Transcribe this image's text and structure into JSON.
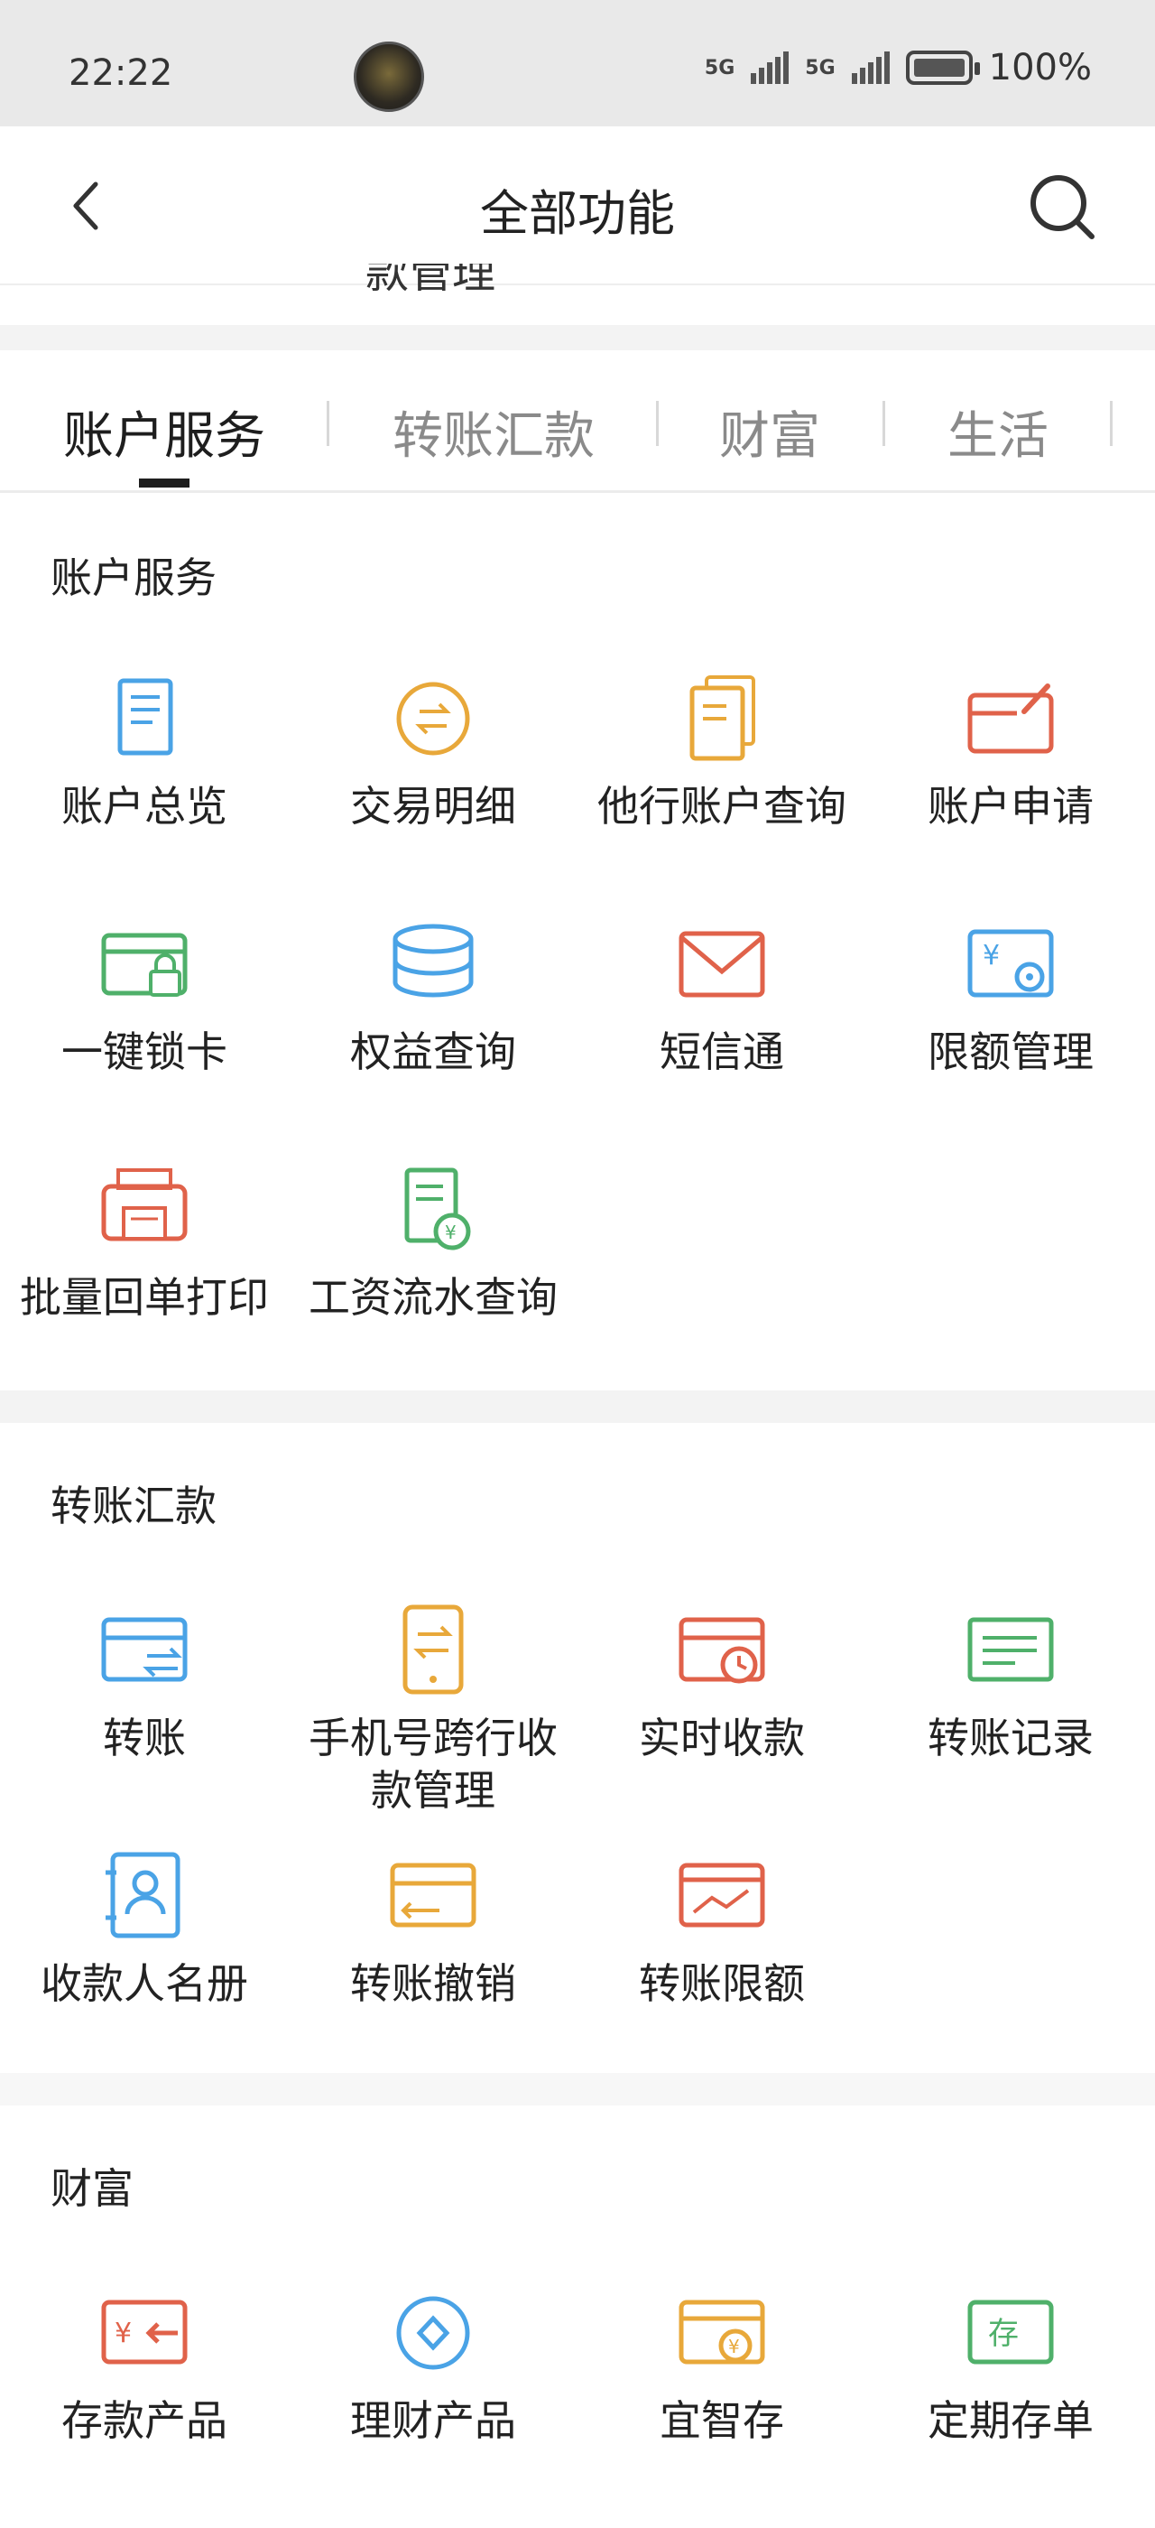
{
  "status_bar": {
    "time": "22:22",
    "network": "5G",
    "network2": "5G",
    "battery_pct": "100%"
  },
  "header": {
    "title": "全部功能"
  },
  "cut_off_text": "款管理",
  "tabs": [
    {
      "label": "账户服务",
      "active": true
    },
    {
      "label": "转账汇款",
      "active": false
    },
    {
      "label": "财富",
      "active": false
    },
    {
      "label": "生活",
      "active": false
    }
  ],
  "sections": {
    "account": {
      "title": "账户服务",
      "items": [
        {
          "label": "账户总览",
          "icon": "document-icon",
          "color": "#4aa3e6"
        },
        {
          "label": "交易明细",
          "icon": "exchange-circle-icon",
          "color": "#e8a83a"
        },
        {
          "label": "他行账户查询",
          "icon": "stacked-docs-icon",
          "color": "#e8a83a"
        },
        {
          "label": "账户申请",
          "icon": "card-edit-icon",
          "color": "#e0624a"
        },
        {
          "label": "一键锁卡",
          "icon": "card-lock-icon",
          "color": "#4fb06a"
        },
        {
          "label": "权益查询",
          "icon": "database-icon",
          "color": "#4aa3e6"
        },
        {
          "label": "短信通",
          "icon": "envelope-icon",
          "color": "#e0624a"
        },
        {
          "label": "限额管理",
          "icon": "yen-gear-icon",
          "color": "#4aa3e6"
        },
        {
          "label": "批量回单打印",
          "icon": "printer-icon",
          "color": "#e0624a"
        },
        {
          "label": "工资流水查询",
          "icon": "salary-doc-icon",
          "color": "#4fb06a"
        }
      ]
    },
    "transfer": {
      "title": "转账汇款",
      "items": [
        {
          "label": "转账",
          "icon": "card-transfer-icon",
          "color": "#4aa3e6"
        },
        {
          "label": "手机号跨行收款管理",
          "icon": "phone-exchange-icon",
          "color": "#e8a83a"
        },
        {
          "label": "实时收款",
          "icon": "card-clock-icon",
          "color": "#e0624a"
        },
        {
          "label": "转账记录",
          "icon": "record-icon",
          "color": "#4fb06a"
        },
        {
          "label": "收款人名册",
          "icon": "contact-book-icon",
          "color": "#4aa3e6"
        },
        {
          "label": "转账撤销",
          "icon": "card-undo-icon",
          "color": "#e8a83a"
        },
        {
          "label": "转账限额",
          "icon": "card-chart-icon",
          "color": "#e0624a"
        }
      ]
    },
    "wealth": {
      "title": "财富",
      "items": [
        {
          "label": "存款产品",
          "icon": "yen-arrow-icon",
          "color": "#e0624a"
        },
        {
          "label": "理财产品",
          "icon": "diamond-circle-icon",
          "color": "#4aa3e6"
        },
        {
          "label": "宜智存",
          "icon": "card-coin-icon",
          "color": "#e8a83a"
        },
        {
          "label": "定期存单",
          "icon": "deposit-card-icon",
          "color": "#4fb06a",
          "glyph": "存"
        }
      ]
    }
  }
}
